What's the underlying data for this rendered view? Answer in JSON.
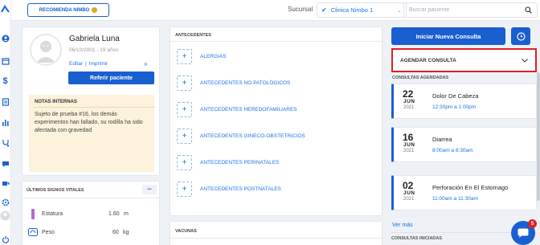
{
  "header": {
    "recommend_label": "RECOMIENDA NIMBO",
    "sucursal_label": "Sucursal",
    "sucursal_value": "Clinica Nimbo 1",
    "search_placeholder": "Buscar paciente"
  },
  "patient": {
    "name": "Gabriela Luna",
    "birth": "06/10/2001 - 19 años",
    "edit_label": "Editar",
    "separator": "|",
    "print_label": "Imprimir",
    "refer_label": "Referir paciente",
    "notes_title": "NOTAS INTERNAS",
    "notes_text": "Sujeto de prueba #16, los demás experimentos han fallado, su rodilla ha sido afectada con gravedad"
  },
  "vitals": {
    "title": "ÚLTIMOS SIGNOS VITALES",
    "more_label": "•••",
    "items": [
      {
        "label": "Estatura",
        "value": "1.60",
        "unit": "m"
      },
      {
        "label": "Peso",
        "value": "60",
        "unit": "kg"
      }
    ]
  },
  "antecedentes": {
    "title": "ANTECEDENTES",
    "add_symbol": "+",
    "items": [
      "ALERGIAS",
      "ANTECEDENTES NO PATOLÓGICOS",
      "ANTECEDENTES HEREDOFAMILIARES",
      "ANTECEDENTES GINECO-OBSTETRICIOS",
      "ANTECEDENTES PERINATALES",
      "ANTECEDENTES POSTNATALES"
    ]
  },
  "vacunas": {
    "title": "VACUNAS"
  },
  "right": {
    "new_consult_label": "Iniciar Nueva Consulta",
    "schedule_label": "AGENDAR CONSULTA",
    "scheduled_title": "CONSULTAS AGENDADAS",
    "consults": [
      {
        "day": "22",
        "month": "JUN",
        "year": "2021",
        "title": "Dolor De Cabeza",
        "time": "12:30pm a 1:00pm"
      },
      {
        "day": "16",
        "month": "JUN",
        "year": "2021",
        "title": "Diarrea",
        "time": "8:00am a 8:30am"
      },
      {
        "day": "02",
        "month": "JUN",
        "year": "2021",
        "title": "Perforación En El Estomago",
        "time": "11:00am a 11:30am"
      }
    ],
    "see_more_label": "Ver más",
    "started_title": "CONSULTAS INICIADAS",
    "chat_badge": "5"
  },
  "colors": {
    "accent": "#1a73e8",
    "button": "#1a5fd0",
    "highlight": "#e02020",
    "notes_bg": "#fdf3dc"
  }
}
